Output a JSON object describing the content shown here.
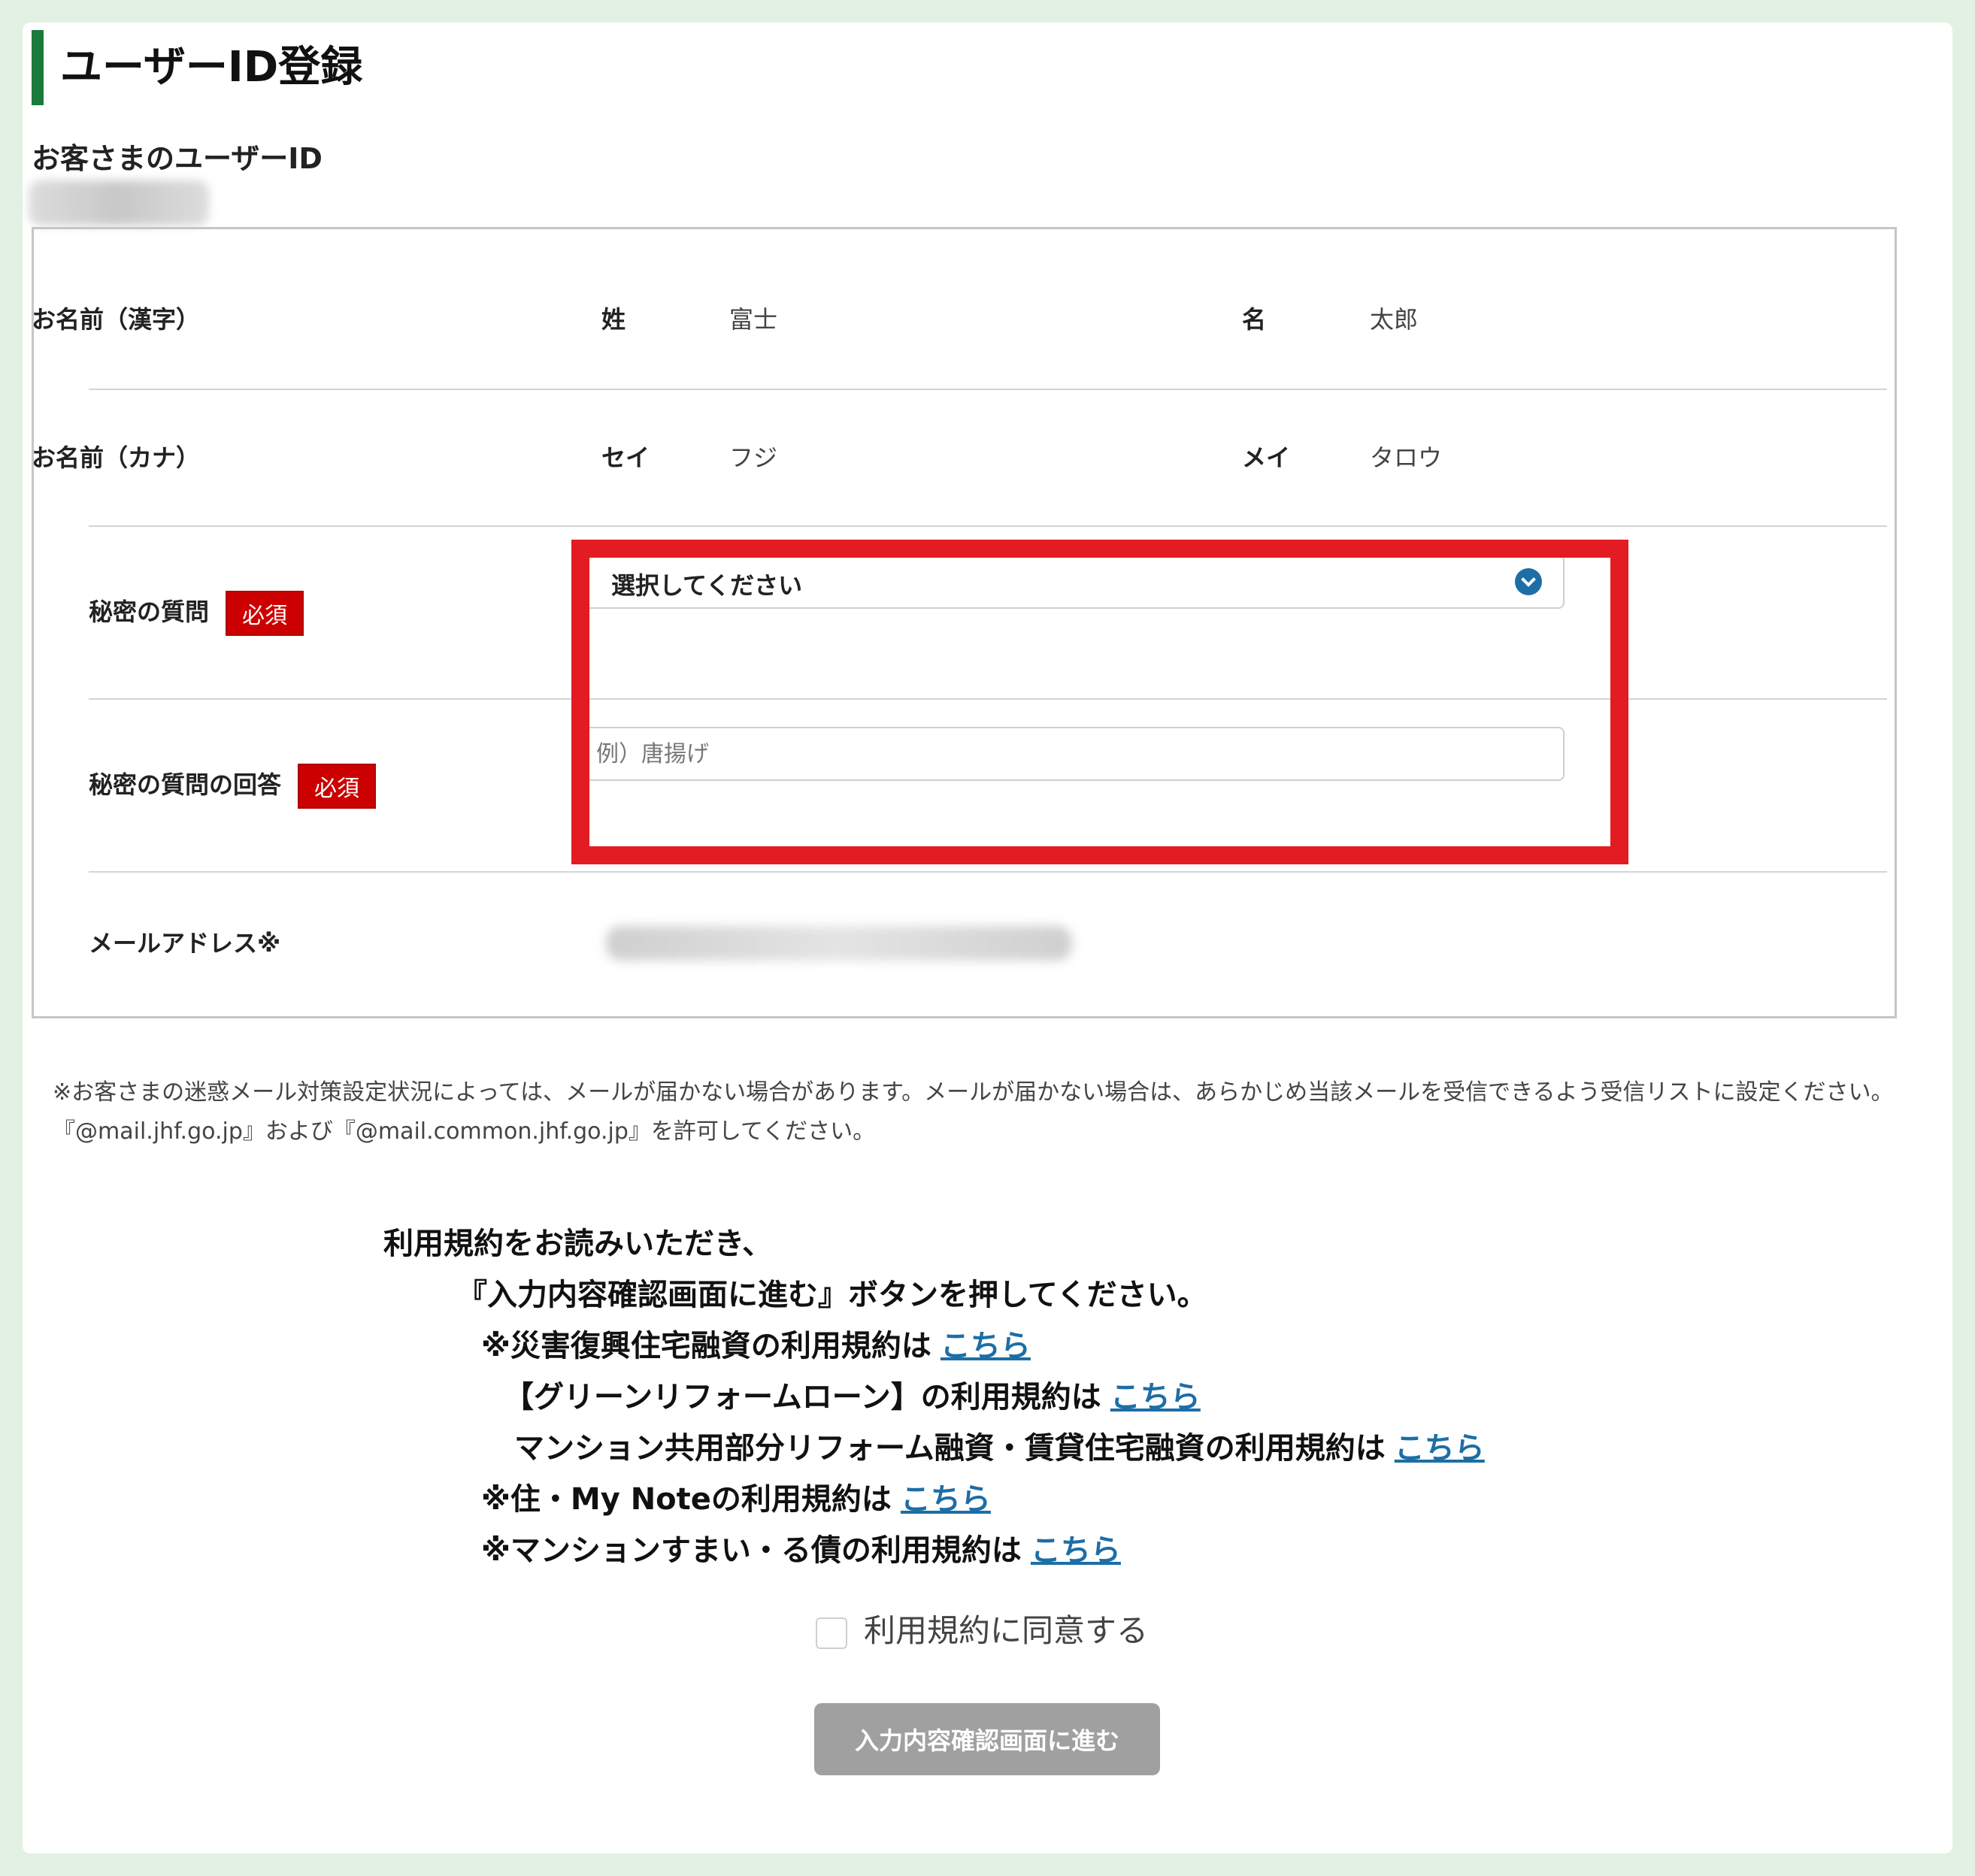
{
  "page": {
    "title": "ユーザーID登録",
    "user_id_label": "お客さまのユーザーID",
    "user_id_value": ""
  },
  "form": {
    "name_kanji": {
      "label": "お名前（漢字）",
      "sei_label": "姓",
      "sei_value": "富士",
      "mei_label": "名",
      "mei_value": "太郎"
    },
    "name_kana": {
      "label": "お名前（カナ）",
      "sei_label": "セイ",
      "sei_value": "フジ",
      "mei_label": "メイ",
      "mei_value": "タロウ"
    },
    "secret_question": {
      "label": "秘密の質問",
      "required": "必須",
      "selected": "選択してください"
    },
    "secret_answer": {
      "label": "秘密の質問の回答",
      "required": "必須",
      "placeholder": "例）唐揚げ"
    },
    "email": {
      "label": "メールアドレス※",
      "value": ""
    }
  },
  "note": "※お客さまの迷惑メール対策設定状況によっては、メールが届かない場合があります。メールが届かない場合は、あらかじめ当該メールを受信できるよう受信リストに設定ください。『@mail.jhf.go.jp』および『@mail.common.jhf.go.jp』を許可してください。",
  "terms": {
    "line1": "利用規約をお読みいただき、",
    "line2": "『入力内容確認画面に進む』ボタンを押してください。",
    "links": [
      {
        "text": "※災害復興住宅融資の利用規約は",
        "link": "こちら"
      },
      {
        "text": "【グリーンリフォームローン】の利用規約は",
        "link": "こちら"
      },
      {
        "text": "マンション共用部分リフォーム融資・賃貸住宅融資の利用規約は",
        "link": "こちら"
      },
      {
        "text": "※住・My Noteの利用規約は",
        "link": "こちら"
      },
      {
        "text": "※マンションすまい・る債の利用規約は",
        "link": "こちら"
      }
    ]
  },
  "agree_label": "利用規約に同意する",
  "submit_label": "入力内容確認画面に進む",
  "colors": {
    "accent_green": "#1a7a3a",
    "required_red": "#cc0000",
    "highlight_red": "#e31b23",
    "link_blue": "#1d6ea6",
    "button_disabled": "#a0a0a0"
  }
}
